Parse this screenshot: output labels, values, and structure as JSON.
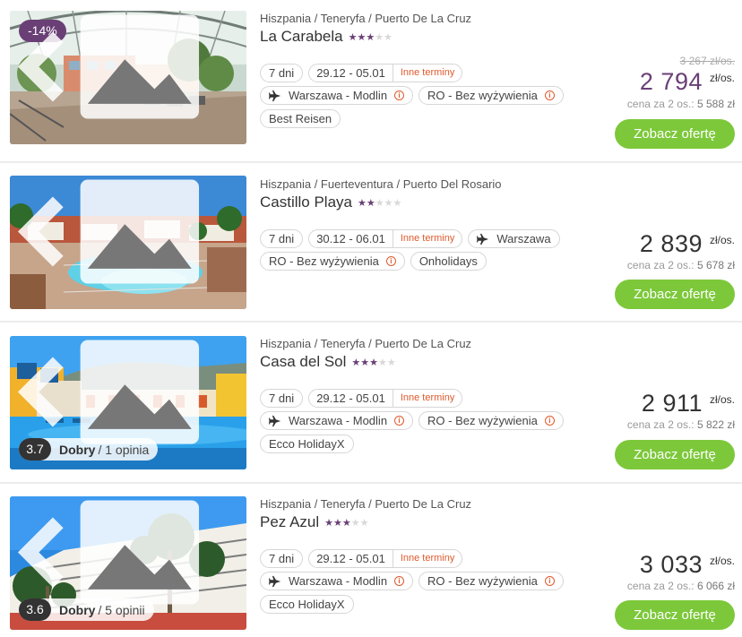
{
  "colors": {
    "accent": "#6a3f76",
    "cta": "#7cc83a",
    "warning": "#e05a2c"
  },
  "offers": [
    {
      "location": "Hiszpania / Teneryfa / Puerto De La Cruz",
      "name": "La Carabela",
      "stars": 3,
      "discount": "-14%",
      "duration": "7 dni",
      "dates": "29.12 - 05.01",
      "other_dates": "Inne terminy",
      "departure": "Warszawa - Modlin",
      "board": "RO - Bez wyżywienia",
      "operator": "Best Reisen",
      "old_price": "3 267 zł/os.",
      "price": "2 794",
      "price_unit": "zł/os.",
      "price_for_two_label": "cena za 2 os.:",
      "price_for_two": "5 588 zł",
      "button": "Zobacz ofertę"
    },
    {
      "location": "Hiszpania / Fuerteventura / Puerto Del Rosario",
      "name": "Castillo Playa",
      "stars": 2,
      "duration": "7 dni",
      "dates": "30.12 - 06.01",
      "other_dates": "Inne terminy",
      "departure": "Warszawa",
      "board": "RO - Bez wyżywienia",
      "operator": "Onholidays",
      "price": "2 839",
      "price_unit": "zł/os.",
      "price_for_two_label": "cena za 2 os.:",
      "price_for_two": "5 678 zł",
      "button": "Zobacz ofertę"
    },
    {
      "location": "Hiszpania / Teneryfa / Puerto De La Cruz",
      "name": "Casa del Sol",
      "stars": 3,
      "rating_score": "3.7",
      "rating_label": "Dobry",
      "rating_count": "/ 1 opinia",
      "duration": "7 dni",
      "dates": "29.12 - 05.01",
      "other_dates": "Inne terminy",
      "departure": "Warszawa - Modlin",
      "board": "RO - Bez wyżywienia",
      "operator": "Ecco HolidayX",
      "price": "2 911",
      "price_unit": "zł/os.",
      "price_for_two_label": "cena za 2 os.:",
      "price_for_two": "5 822 zł",
      "button": "Zobacz ofertę"
    },
    {
      "location": "Hiszpania / Teneryfa / Puerto De La Cruz",
      "name": "Pez Azul",
      "stars": 3,
      "rating_score": "3.6",
      "rating_label": "Dobry",
      "rating_count": "/ 5 opinii",
      "duration": "7 dni",
      "dates": "29.12 - 05.01",
      "other_dates": "Inne terminy",
      "departure": "Warszawa - Modlin",
      "board": "RO - Bez wyżywienia",
      "operator": "Ecco HolidayX",
      "price": "3 033",
      "price_unit": "zł/os.",
      "price_for_two_label": "cena za 2 os.:",
      "price_for_two": "6 066 zł",
      "button": "Zobacz ofertę"
    }
  ]
}
